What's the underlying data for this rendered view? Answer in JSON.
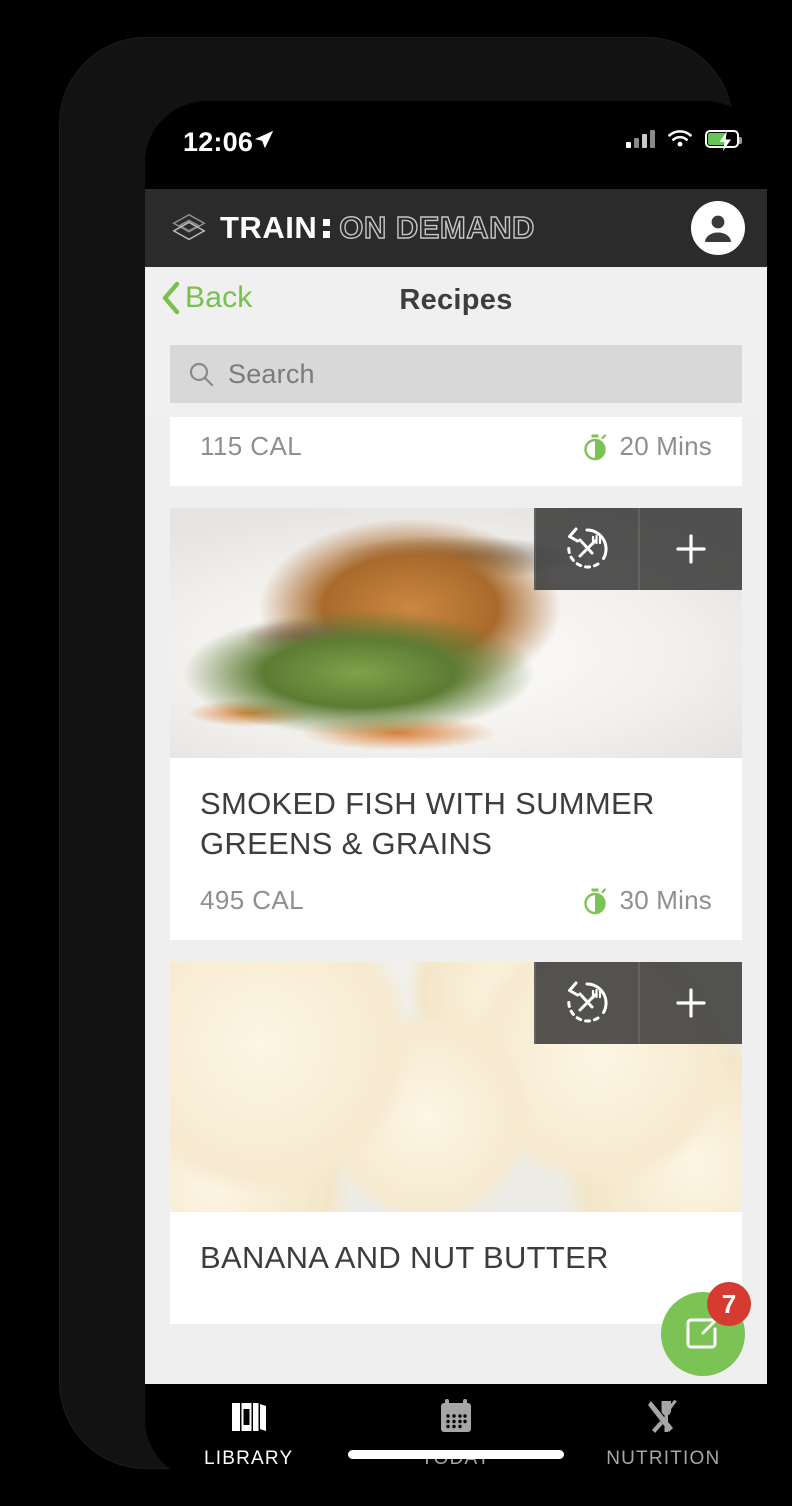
{
  "status_bar": {
    "time": "12:06",
    "location_icon": "location-arrow-icon",
    "signal_icon": "cellular-signal-icon",
    "wifi_icon": "wifi-icon",
    "battery_icon": "battery-charging-icon"
  },
  "app_header": {
    "logo_icon": "train-diamond-logo-icon",
    "brand_primary": "TRAIN",
    "brand_secondary": "ON DEMAND",
    "avatar_icon": "user-avatar-icon",
    "background_color": "#2b2b2b"
  },
  "nav_bar": {
    "back_label": "Back",
    "back_icon": "chevron-left-icon",
    "title": "Recipes",
    "accent_color": "#76c04e"
  },
  "search": {
    "placeholder": "Search",
    "value": "",
    "icon": "search-icon"
  },
  "actions": {
    "swap_icon": "swap-meal-icon",
    "add_icon": "plus-icon"
  },
  "recipes": [
    {
      "title": "",
      "calories": "115 CAL",
      "time": "20 Mins",
      "time_icon": "stopwatch-icon",
      "photo": "partial-recipe-photo"
    },
    {
      "title": "SMOKED FISH WITH SUMMER GREENS & GRAINS",
      "calories": "495 CAL",
      "time": "30 Mins",
      "time_icon": "stopwatch-icon",
      "photo": "smoked-fish-photo"
    },
    {
      "title": "BANANA AND NUT BUTTER",
      "calories": "",
      "time": "",
      "time_icon": "stopwatch-icon",
      "photo": "banana-nut-butter-photo"
    }
  ],
  "fab": {
    "icon": "compose-icon",
    "badge_count": "7",
    "color": "#7cc355",
    "badge_color": "#d63b32"
  },
  "tab_bar": {
    "items": [
      {
        "label": "LIBRARY",
        "icon": "books-icon",
        "active": true
      },
      {
        "label": "TODAY",
        "icon": "calendar-icon",
        "active": false
      },
      {
        "label": "NUTRITION",
        "icon": "fork-knife-icon",
        "active": false
      }
    ]
  }
}
